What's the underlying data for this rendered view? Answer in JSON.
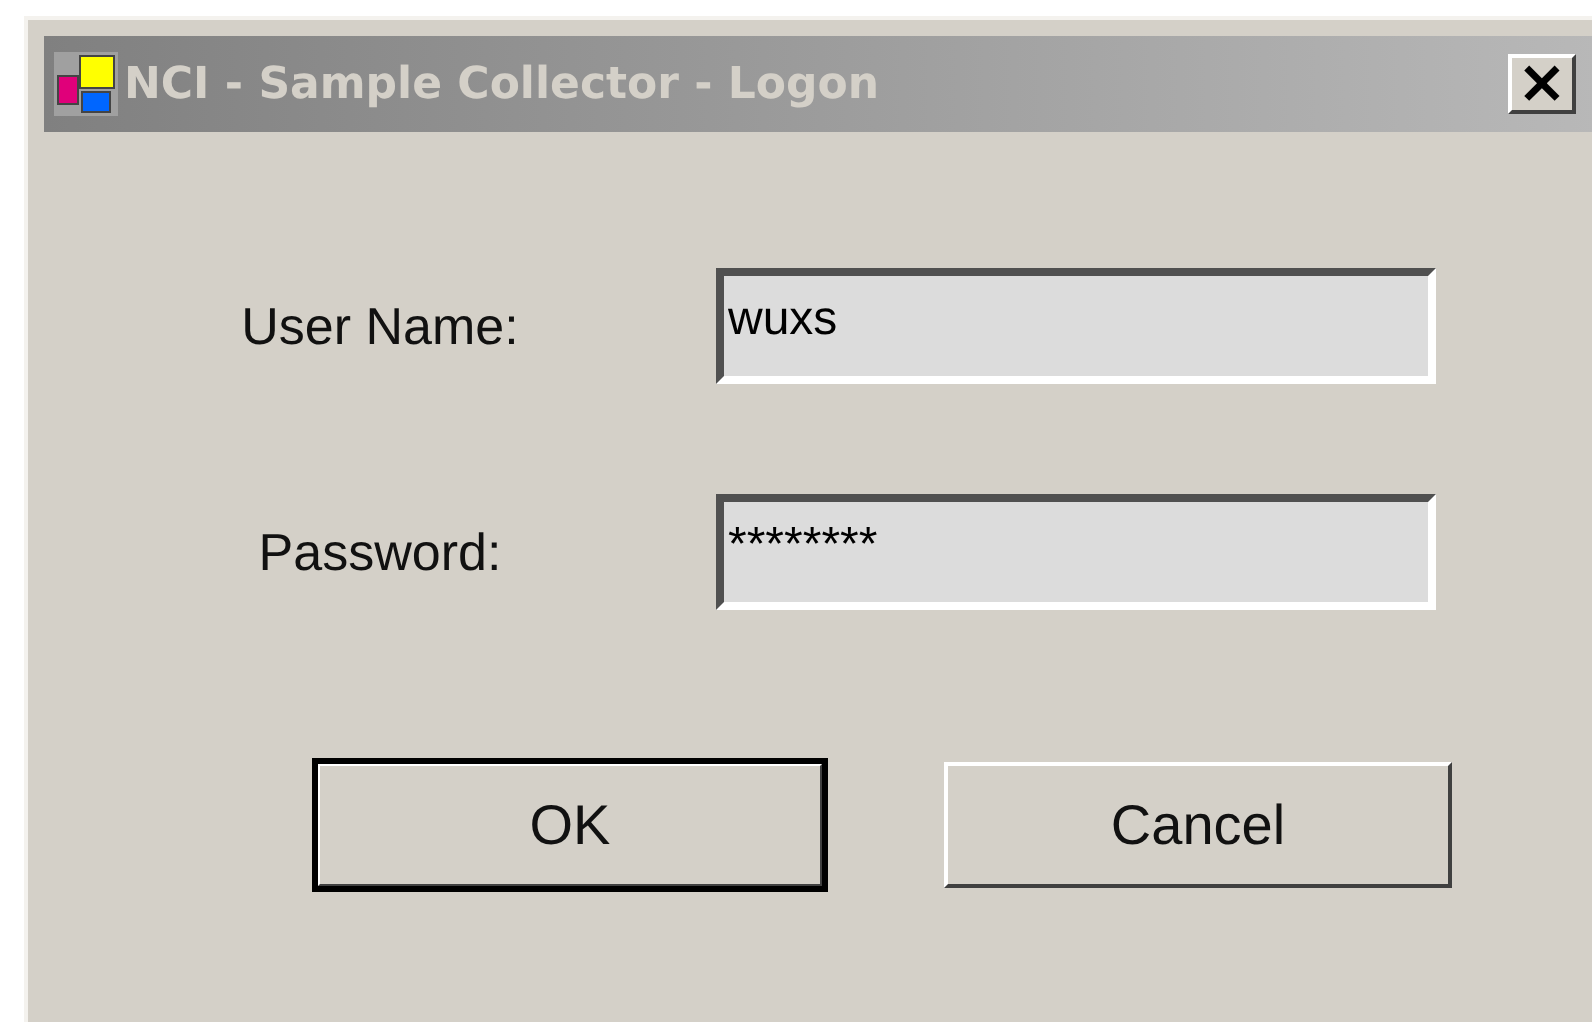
{
  "window": {
    "title": "NCI - Sample Collector - Logon",
    "active": false,
    "close": "×"
  },
  "fields": [
    {
      "label": "User Name:",
      "value": "wuxs"
    },
    {
      "label": "Password:",
      "value": "********"
    }
  ],
  "buttons": [
    {
      "label": "OK",
      "default": true
    },
    {
      "label": "Cancel",
      "default": false
    }
  ]
}
